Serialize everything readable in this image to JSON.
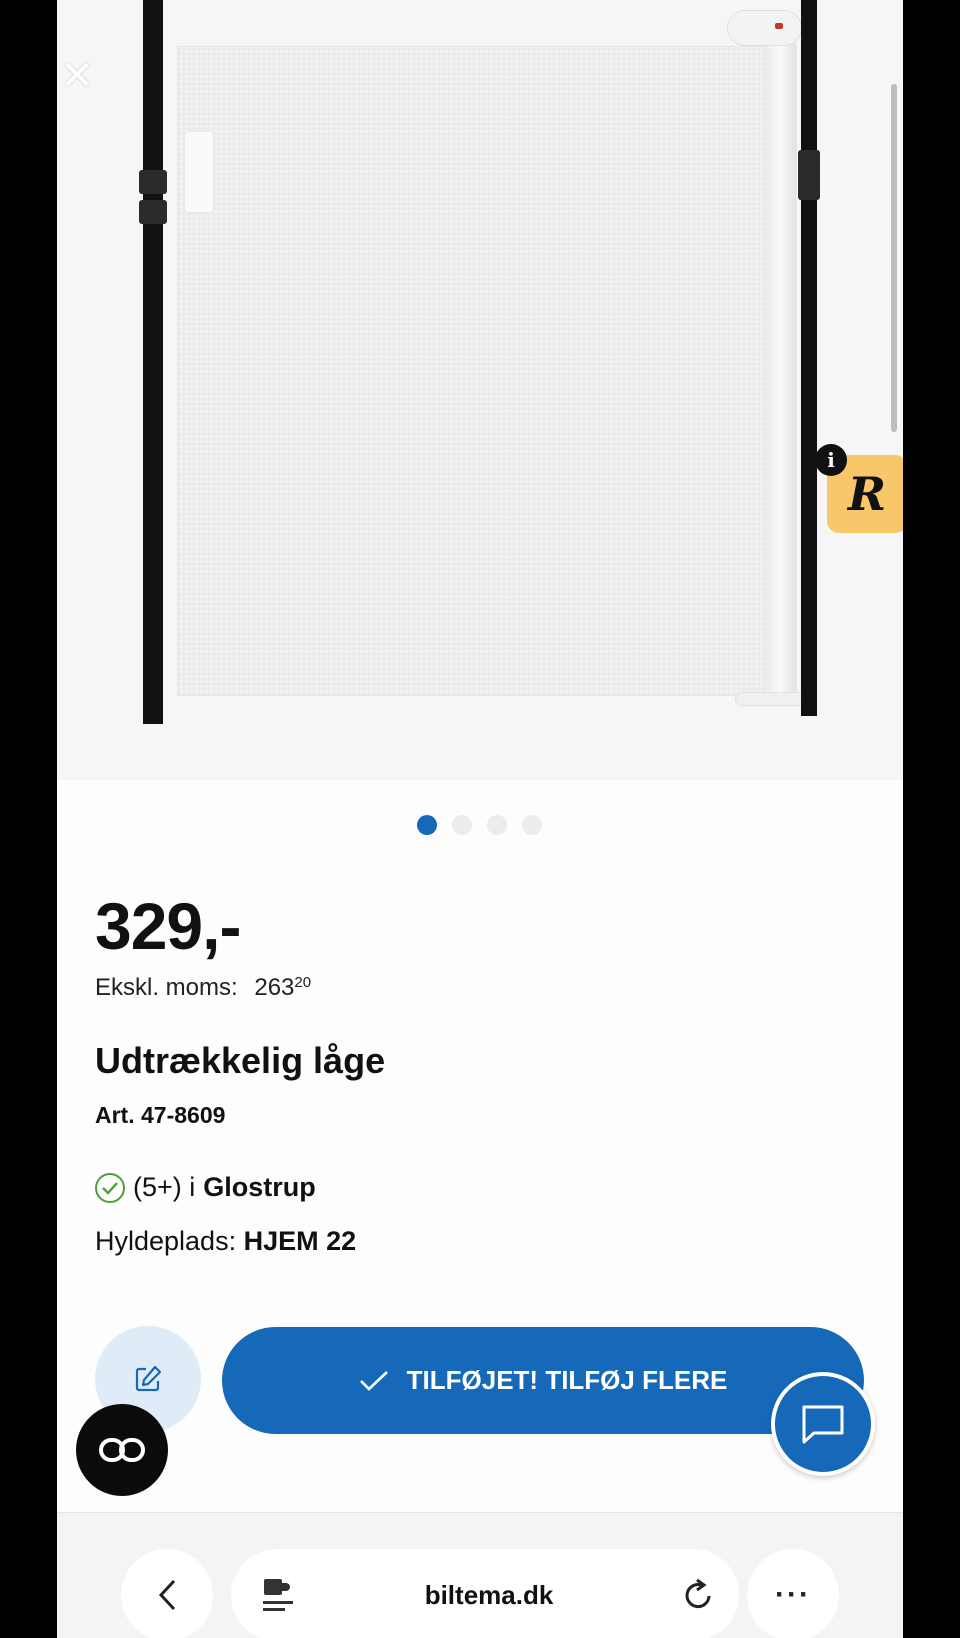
{
  "product": {
    "price": "329,-",
    "excl_label": "Ekskl. moms:",
    "excl_amount": "263",
    "excl_cents": "20",
    "title": "Udtrækkelig låge",
    "article": "Art. 47-8609",
    "stock_count": "(5+) i",
    "stock_location": "Glostrup",
    "shelf_label": "Hyldeplads:",
    "shelf_value": "HJEM 22"
  },
  "gallery": {
    "total_images": 4,
    "active_index": 0
  },
  "overlay": {
    "close_icon": "close-icon",
    "info_label": "i",
    "badge_letter": "R"
  },
  "actions": {
    "add_label": "TILFØJET! TILFØJ FLERE",
    "edit_icon": "edit-icon",
    "chat_icon": "chat-icon",
    "link_icon": "link-icon"
  },
  "browser": {
    "url": "biltema.dk",
    "more_label": "···"
  },
  "colors": {
    "accent": "#1668b8",
    "stock_ok": "#4f9e3a",
    "badge": "#f7c76a"
  }
}
